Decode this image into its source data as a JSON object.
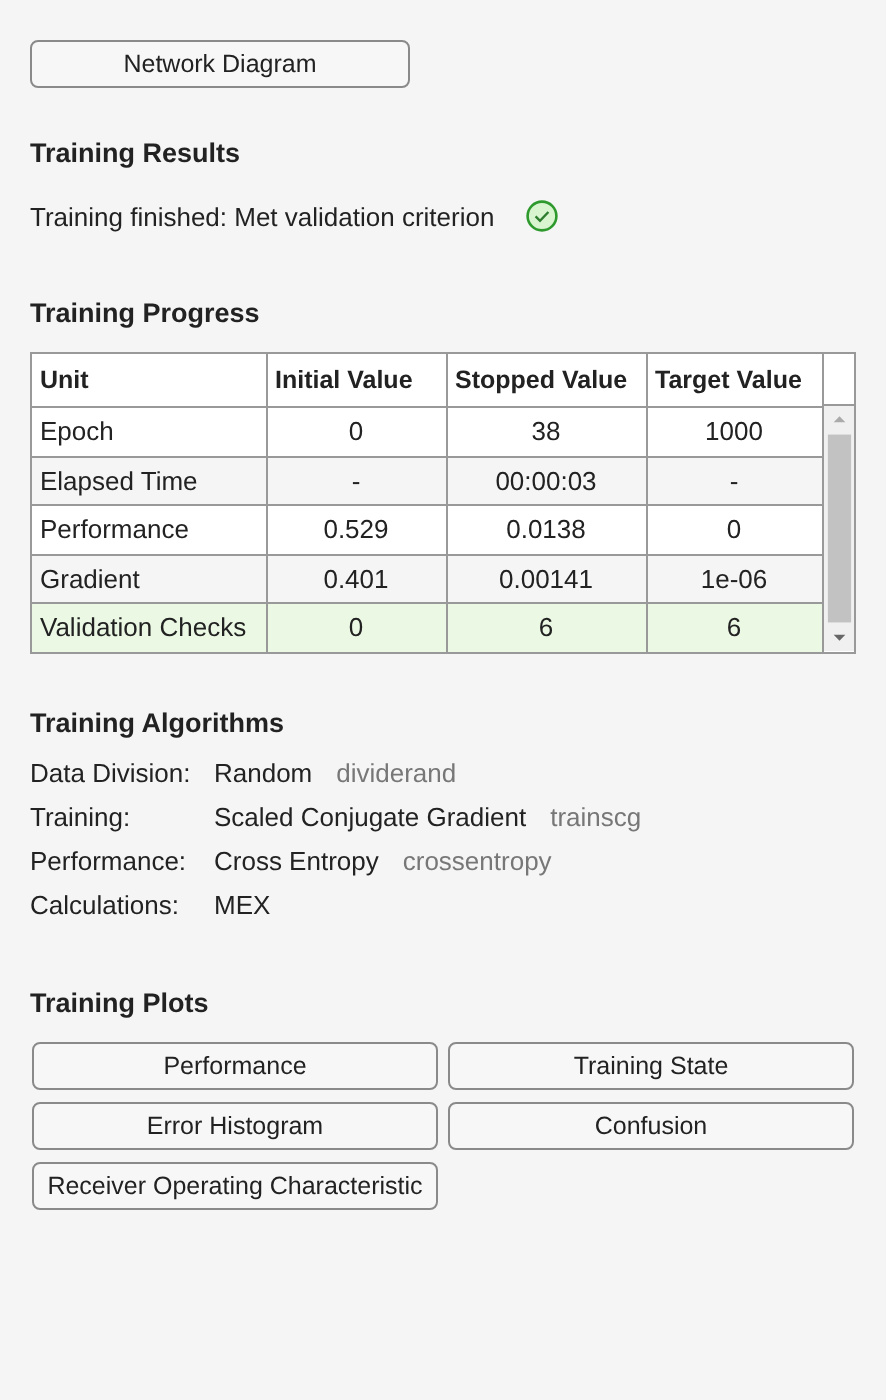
{
  "network_button": {
    "label": "Network Diagram"
  },
  "training_results": {
    "title": "Training Results",
    "status": "Training finished: Met validation criterion",
    "status_ok": true
  },
  "training_progress": {
    "title": "Training Progress",
    "columns": [
      "Unit",
      "Initial Value",
      "Stopped Value",
      "Target Value"
    ],
    "rows": [
      {
        "cells": [
          "Epoch",
          "0",
          "38",
          "1000"
        ],
        "highlighted": false
      },
      {
        "cells": [
          "Elapsed Time",
          "-",
          "00:00:03",
          "-"
        ],
        "highlighted": false
      },
      {
        "cells": [
          "Performance",
          "0.529",
          "0.0138",
          "0"
        ],
        "highlighted": false
      },
      {
        "cells": [
          "Gradient",
          "0.401",
          "0.00141",
          "1e-06"
        ],
        "highlighted": false
      },
      {
        "cells": [
          "Validation Checks",
          "0",
          "6",
          "6"
        ],
        "highlighted": true
      }
    ]
  },
  "training_algorithms": {
    "title": "Training Algorithms",
    "items": [
      {
        "label": "Data Division:",
        "value": "Random",
        "function": "dividerand"
      },
      {
        "label": "Training:",
        "value": "Scaled Conjugate Gradient",
        "function": "trainscg"
      },
      {
        "label": "Performance:",
        "value": "Cross Entropy",
        "function": "crossentropy"
      },
      {
        "label": "Calculations:",
        "value": "MEX"
      }
    ]
  },
  "training_plots": {
    "title": "Training Plots",
    "buttons": [
      "Performance",
      "Training State",
      "Error Histogram",
      "Confusion",
      "Receiver Operating Characteristic"
    ]
  }
}
